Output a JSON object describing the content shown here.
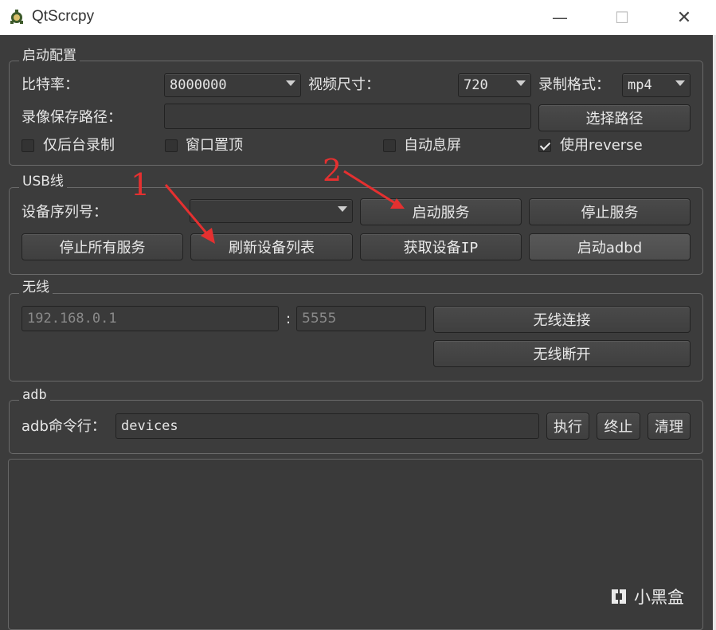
{
  "window": {
    "title": "QtScrcpy",
    "minimize": "—",
    "maximize": "☐",
    "close": "✕"
  },
  "startup_config": {
    "title": "启动配置",
    "bitrate_label": "比特率：",
    "bitrate_value": "8000000",
    "video_size_label": "视频尺寸：",
    "video_size_value": "720",
    "record_format_label": "录制格式：",
    "record_format_value": "mp4",
    "record_path_label": "录像保存路径：",
    "record_path_value": "",
    "select_path_button": "选择路径",
    "checkboxes": [
      {
        "label": "仅后台录制",
        "checked": false
      },
      {
        "label": "窗口置顶",
        "checked": false
      },
      {
        "label": "自动息屏",
        "checked": false
      },
      {
        "label": "使用reverse",
        "checked": true
      }
    ]
  },
  "usb": {
    "title": "USB线",
    "serial_label": "设备序列号：",
    "serial_value": "",
    "start_service": "启动服务",
    "stop_service": "停止服务",
    "stop_all_services": "停止所有服务",
    "refresh_devices": "刷新设备列表",
    "get_device_ip": "获取设备IP",
    "start_adbd": "启动adbd"
  },
  "wireless": {
    "title": "无线",
    "ip_placeholder": "192.168.0.1",
    "colon": ":",
    "port_placeholder": "5555",
    "connect": "无线连接",
    "disconnect": "无线断开"
  },
  "adb": {
    "title": "adb",
    "cmd_label": "adb命令行：",
    "cmd_value": "devices",
    "execute": "执行",
    "terminate": "终止",
    "clear": "清理"
  },
  "annotations": {
    "one": "1",
    "two": "2",
    "color": "#e53030"
  },
  "watermark": {
    "text": "小黑盒"
  },
  "colors": {
    "background": "#3c3c3c",
    "text": "#e6e6e6"
  }
}
